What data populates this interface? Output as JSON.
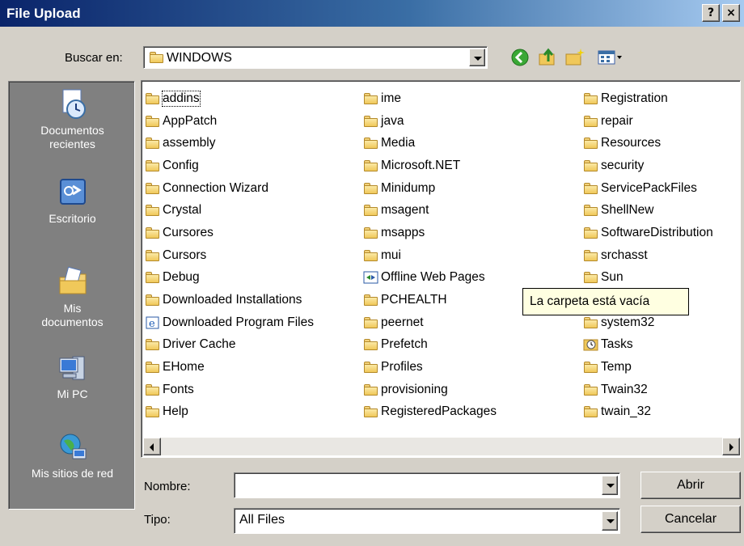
{
  "window": {
    "title": "File Upload",
    "help_label": "?",
    "close_label": "×"
  },
  "look_in": {
    "label": "Buscar en:",
    "value": "WINDOWS"
  },
  "places": [
    {
      "label": "Documentos\nrecientes",
      "icon": "recent-documents-icon"
    },
    {
      "label": "Escritorio",
      "icon": "desktop-icon"
    },
    {
      "label": "Mis\ndocumentos",
      "icon": "my-documents-icon"
    },
    {
      "label": "Mi PC",
      "icon": "my-computer-icon"
    },
    {
      "label": "Mis sitios de red",
      "icon": "network-places-icon"
    }
  ],
  "files": {
    "col1": [
      "addins",
      "AppPatch",
      "assembly",
      "Config",
      "Connection Wizard",
      "Crystal",
      "Cursores",
      "Cursors",
      "Debug",
      "Downloaded Installations",
      "Downloaded Program Files",
      "Driver Cache",
      "EHome",
      "Fonts",
      "Help"
    ],
    "col2": [
      "ime",
      "java",
      "Media",
      "Microsoft.NET",
      "Minidump",
      "msagent",
      "msapps",
      "mui",
      "Offline Web Pages",
      "PCHEALTH",
      "peernet",
      "Prefetch",
      "Profiles",
      "provisioning",
      "RegisteredPackages"
    ],
    "col3": [
      "Registration",
      "repair",
      "Resources",
      "security",
      "ServicePackFiles",
      "ShellNew",
      "SoftwareDistribution",
      "srchasst",
      "Sun",
      "",
      "system32",
      "Tasks",
      "Temp",
      "Twain32",
      "twain_32"
    ]
  },
  "tooltip": "La carpeta está vacía",
  "filename": {
    "label": "Nombre:",
    "value": ""
  },
  "filetype": {
    "label": "Tipo:",
    "value": "All Files"
  },
  "buttons": {
    "open": "Abrir",
    "cancel": "Cancelar"
  },
  "colors": {
    "title_start": "#0a246a",
    "title_end": "#a6caf0",
    "places_bg": "#808080",
    "tooltip_bg": "#ffffe1"
  }
}
